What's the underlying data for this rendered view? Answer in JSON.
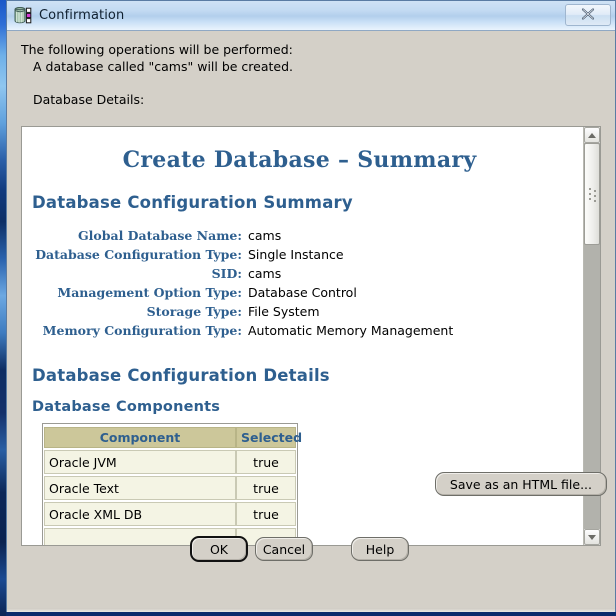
{
  "window": {
    "title": "Confirmation",
    "icon": "database-icon",
    "close_label": "✕"
  },
  "intro": {
    "line1": "The following operations will be performed:",
    "line2": "A database called \"cams\" will be created.",
    "line3": "Database Details:"
  },
  "document": {
    "title": "Create Database – Summary",
    "section1_heading": "Database Configuration Summary",
    "summary_rows": [
      {
        "label": "Global Database Name:",
        "value": "cams"
      },
      {
        "label": "Database Configuration Type:",
        "value": "Single Instance"
      },
      {
        "label": "SID:",
        "value": "cams"
      },
      {
        "label": "Management Option Type:",
        "value": "Database Control"
      },
      {
        "label": "Storage Type:",
        "value": "File System"
      },
      {
        "label": "Memory Configuration Type:",
        "value": "Automatic Memory Management"
      }
    ],
    "section2_heading": "Database Configuration Details",
    "section3_heading": "Database Components",
    "components_table": {
      "headers": [
        "Component",
        "Selected"
      ],
      "rows": [
        [
          "Oracle JVM",
          "true"
        ],
        [
          "Oracle Text",
          "true"
        ],
        [
          "Oracle XML DB",
          "true"
        ]
      ]
    }
  },
  "scrollbar": {
    "up_arrow": "scroll-up-icon",
    "down_arrow": "scroll-down-icon"
  },
  "buttons": {
    "save_html": "Save as an HTML file...",
    "ok": "OK",
    "cancel": "Cancel",
    "help": "Help"
  },
  "colors": {
    "heading_blue": "#2e5f8f",
    "table_header_bg": "#ccc79a",
    "table_row_bg": "#f4f4e4",
    "dialog_bg": "#d4d0c8",
    "titlebar_blue": "#c3dbf2"
  }
}
